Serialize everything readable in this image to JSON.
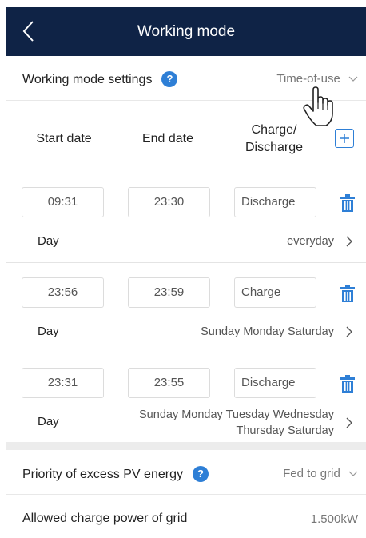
{
  "header": {
    "title": "Working mode"
  },
  "working_mode": {
    "label": "Working mode settings",
    "value": "Time-of-use"
  },
  "columns": {
    "start": "Start date",
    "end": "End date",
    "charge_line1": "Charge/",
    "charge_line2": "Discharge"
  },
  "entries": [
    {
      "start": "09:31",
      "end": "23:30",
      "mode": "Discharge",
      "day_label": "Day",
      "day_value_line1": "everyday",
      "day_value_line2": ""
    },
    {
      "start": "23:56",
      "end": "23:59",
      "mode": "Charge",
      "day_label": "Day",
      "day_value_line1": "Sunday Monday Saturday",
      "day_value_line2": ""
    },
    {
      "start": "23:31",
      "end": "23:55",
      "mode": "Discharge",
      "day_label": "Day",
      "day_value_line1": "Sunday Monday Tuesday Wednesday",
      "day_value_line2": "Thursday Saturday"
    }
  ],
  "priority": {
    "label": "Priority of excess PV energy",
    "value": "Fed to grid"
  },
  "charge_power": {
    "label": "Allowed charge power of grid",
    "value": "1.500kW"
  },
  "colors": {
    "header_bg": "#0f2346",
    "accent": "#2e7fd6"
  },
  "icons": [
    "back-chevron-icon",
    "help-icon",
    "chevron-down-icon",
    "add-icon",
    "trash-icon",
    "chevron-right-icon",
    "hand-cursor-icon"
  ]
}
